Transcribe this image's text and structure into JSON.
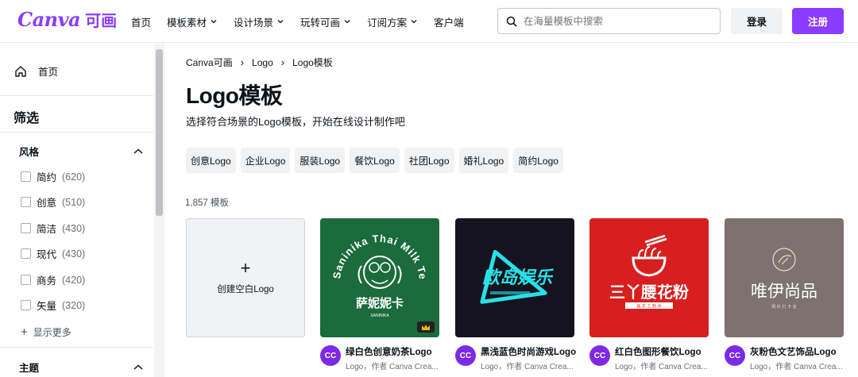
{
  "header": {
    "logo_text": "Canva",
    "logo_cn": "可画",
    "nav": [
      {
        "label": "首页",
        "dropdown": false
      },
      {
        "label": "模板素材",
        "dropdown": true
      },
      {
        "label": "设计场景",
        "dropdown": true
      },
      {
        "label": "玩转可画",
        "dropdown": true
      },
      {
        "label": "订阅方案",
        "dropdown": true
      },
      {
        "label": "客户端",
        "dropdown": false
      }
    ],
    "search_placeholder": "在海量模板中搜索",
    "login": "登录",
    "register": "注册",
    "accent": "#8b3dff"
  },
  "sidebar": {
    "home": "首页",
    "filter_title": "筛选",
    "style_section": "风格",
    "style_options": [
      {
        "label": "简约",
        "count": "(620)"
      },
      {
        "label": "创意",
        "count": "(510)"
      },
      {
        "label": "简洁",
        "count": "(430)"
      },
      {
        "label": "现代",
        "count": "(430)"
      },
      {
        "label": "商务",
        "count": "(420)"
      },
      {
        "label": "矢量",
        "count": "(320)"
      }
    ],
    "show_more": "显示更多",
    "theme_section": "主题"
  },
  "main": {
    "breadcrumb": [
      "Canva可画",
      "Logo",
      "Logo模板"
    ],
    "title": "Logo模板",
    "subtitle": "选择符合场景的Logo模板，开始在线设计制作吧",
    "chips": [
      "创意Logo",
      "企业Logo",
      "服装Logo",
      "餐饮Logo",
      "社团Logo",
      "婚礼Logo",
      "简约Logo"
    ],
    "count": "1,857 模板",
    "create_blank": "创建空白Logo",
    "templates": [
      {
        "title": "绿白色创意奶茶Logo",
        "sub": "Logo，作者 Canva Crea...",
        "avatar": "CC",
        "bg": "#1b6b3c",
        "art_main": "萨妮妮卡",
        "art_ring": "Saninika Thai Milk Tea",
        "art_small": "SANINIKA"
      },
      {
        "title": "黑浅蓝色时尚游戏Logo",
        "sub": "Logo，作者 Canva Crea...",
        "avatar": "CC",
        "bg": "#15131f",
        "art_main": "欧岛娱乐"
      },
      {
        "title": "红白色图形餐饮Logo",
        "sub": "Logo，作者 Canva Crea...",
        "avatar": "CC",
        "bg": "#d81f1f",
        "art_main": "三丫腰花粉",
        "art_small": "纯 手 工 制 作"
      },
      {
        "title": "灰粉色文艺饰品Logo",
        "sub": "Logo，作者 Canva Crea...",
        "avatar": "CC",
        "bg": "#7d726d",
        "art_main": "唯伊尚品",
        "art_small": "网 红 打 卡 店"
      }
    ]
  }
}
